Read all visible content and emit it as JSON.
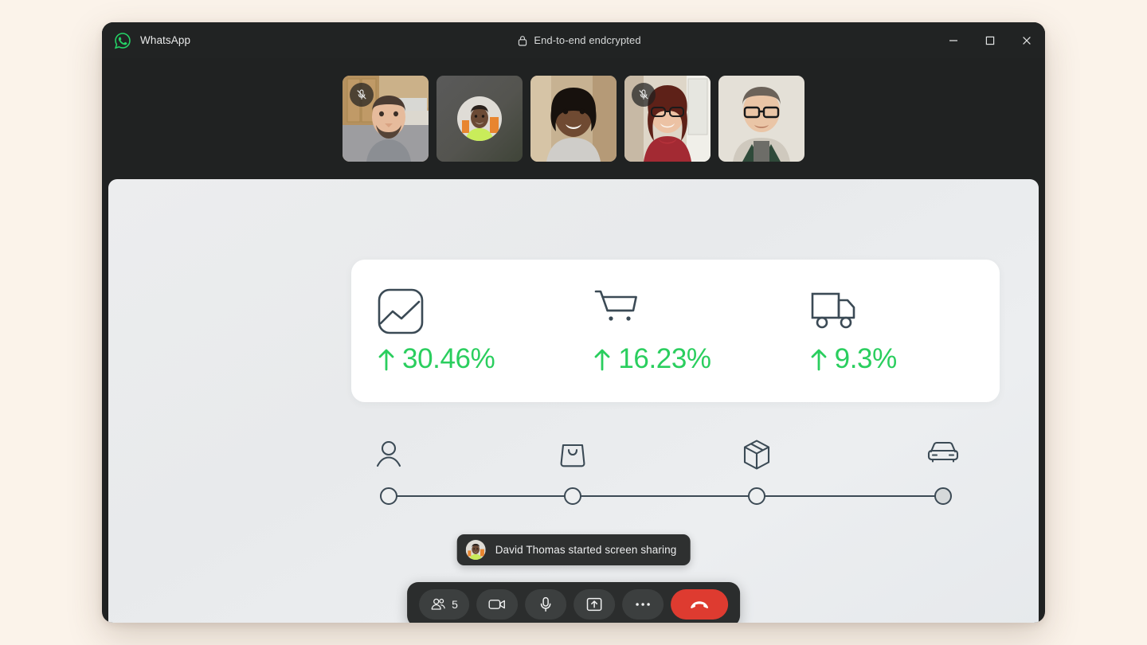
{
  "window": {
    "app_title": "WhatsApp",
    "app_logo_icon": "whatsapp-logo",
    "encryption_label": "End-to-end endcrypted",
    "encryption_icon": "lock-icon",
    "controls": {
      "minimize": "minimize-icon",
      "maximize": "maximize-icon",
      "close": "close-icon"
    }
  },
  "colors": {
    "page_background": "#fbf3ea",
    "window_background": "#202222",
    "accent_green": "#2ace5e",
    "brand_green": "#25d366",
    "end_call_red": "#de3b30",
    "share_surface": "#edeff0",
    "icon_navy": "#3c4a55"
  },
  "filmstrip": {
    "participants": [
      {
        "name": "participant-1",
        "muted": true,
        "video": true,
        "mute_icon": "mic-off-icon"
      },
      {
        "name": "participant-2",
        "muted": false,
        "video": false,
        "avatar": "avatar-image"
      },
      {
        "name": "participant-3",
        "muted": false,
        "video": true
      },
      {
        "name": "participant-4",
        "muted": true,
        "video": true,
        "mute_icon": "mic-off-icon"
      },
      {
        "name": "participant-5",
        "muted": false,
        "video": true
      }
    ]
  },
  "shared_screen": {
    "stats": [
      {
        "icon": "image-chart-icon",
        "trend": "up",
        "arrow": "↑",
        "value": "30.46%"
      },
      {
        "icon": "shopping-cart-icon",
        "trend": "up",
        "arrow": "↑",
        "value": "16.23%"
      },
      {
        "icon": "delivery-truck-icon",
        "trend": "up",
        "arrow": "↑",
        "value": "9.3%"
      }
    ],
    "stepper": {
      "steps": [
        {
          "icon": "user-icon",
          "position_pct": 0,
          "filled": false
        },
        {
          "icon": "shopping-bag-icon",
          "position_pct": 33,
          "filled": false
        },
        {
          "icon": "package-box-icon",
          "position_pct": 66,
          "filled": false
        },
        {
          "icon": "car-icon",
          "position_pct": 100,
          "filled": true
        }
      ]
    }
  },
  "toast": {
    "avatar_icon": "avatar-image",
    "message": "David Thomas started screen sharing"
  },
  "controlbar": {
    "buttons": [
      {
        "name": "participants-button",
        "icon": "people-icon",
        "label": "5"
      },
      {
        "name": "camera-button",
        "icon": "video-camera-icon",
        "label": ""
      },
      {
        "name": "microphone-button",
        "icon": "microphone-icon",
        "label": ""
      },
      {
        "name": "share-screen-button",
        "icon": "screen-share-icon",
        "label": ""
      },
      {
        "name": "more-options-button",
        "icon": "ellipsis-icon",
        "label": ""
      },
      {
        "name": "end-call-button",
        "icon": "phone-hangup-icon",
        "label": ""
      }
    ]
  }
}
